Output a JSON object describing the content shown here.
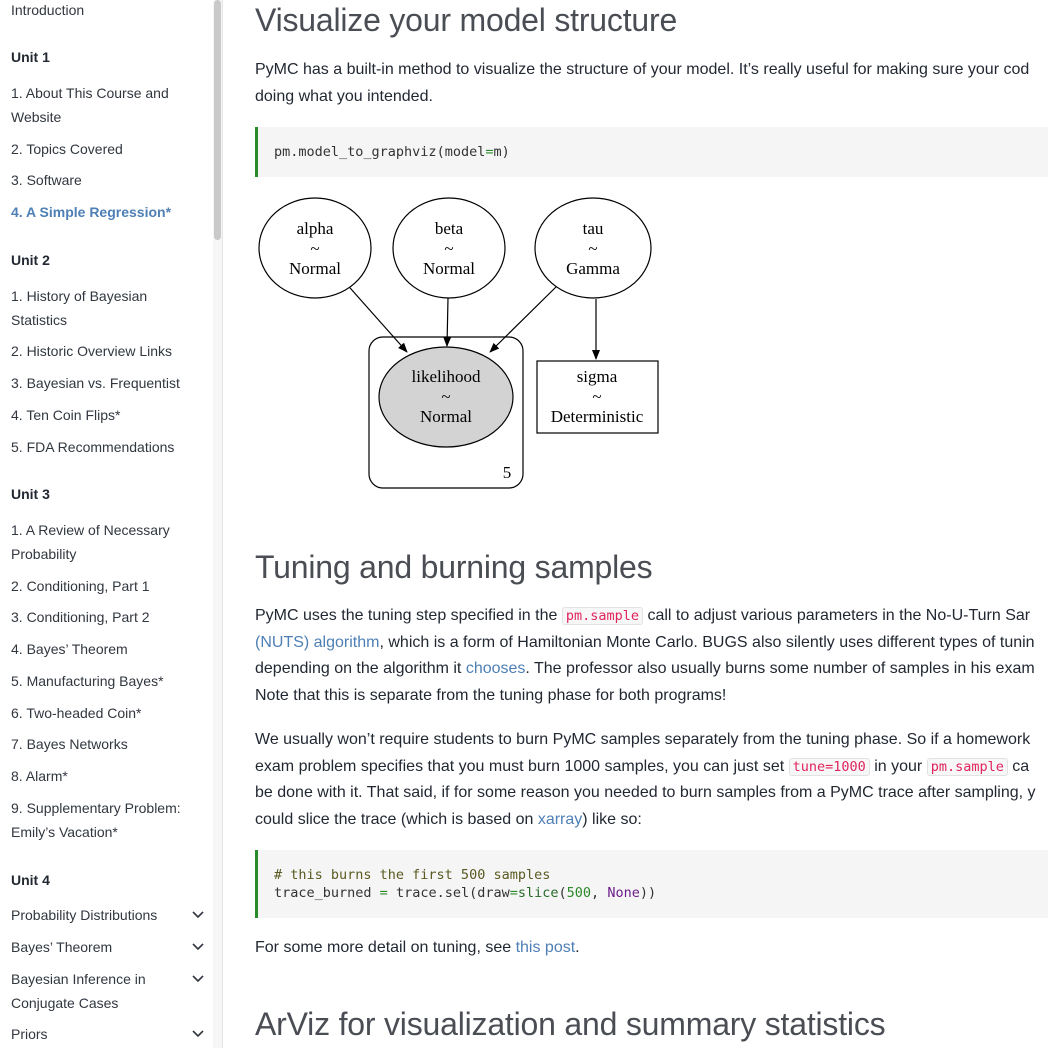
{
  "sidebar": {
    "intro": "Introduction",
    "units": [
      {
        "heading": "Unit 1",
        "items": [
          {
            "label_lines": [
              "1. About This Course and",
              "Website"
            ]
          },
          {
            "label_lines": [
              "2. Topics Covered"
            ]
          },
          {
            "label_lines": [
              "3. Software"
            ]
          },
          {
            "label_lines": [
              "4. A Simple Regression*"
            ],
            "active": true
          }
        ]
      },
      {
        "heading": "Unit 2",
        "items": [
          {
            "label_lines": [
              "1. History of Bayesian",
              "Statistics"
            ]
          },
          {
            "label_lines": [
              "2. Historic Overview Links"
            ]
          },
          {
            "label_lines": [
              "3. Bayesian vs. Frequentist"
            ]
          },
          {
            "label_lines": [
              "4. Ten Coin Flips*"
            ]
          },
          {
            "label_lines": [
              "5. FDA Recommendations"
            ]
          }
        ]
      },
      {
        "heading": "Unit 3",
        "items": [
          {
            "label_lines": [
              "1. A Review of Necessary",
              "Probability"
            ]
          },
          {
            "label_lines": [
              "2. Conditioning, Part 1"
            ]
          },
          {
            "label_lines": [
              "3. Conditioning, Part 2"
            ]
          },
          {
            "label_lines": [
              "4. Bayes’ Theorem"
            ]
          },
          {
            "label_lines": [
              "5. Manufacturing Bayes*"
            ]
          },
          {
            "label_lines": [
              "6. Two-headed Coin*"
            ]
          },
          {
            "label_lines": [
              "7. Bayes Networks"
            ]
          },
          {
            "label_lines": [
              "8. Alarm*"
            ]
          },
          {
            "label_lines": [
              "9. Supplementary Problem:",
              "Emily’s Vacation*"
            ]
          }
        ]
      },
      {
        "heading": "Unit 4",
        "collapsible": [
          {
            "label_lines": [
              "Probability Distributions"
            ]
          },
          {
            "label_lines": [
              "Bayes’ Theorem"
            ]
          },
          {
            "label_lines": [
              "Bayesian Inference in",
              "Conjugate Cases"
            ]
          },
          {
            "label_lines": [
              "Priors"
            ]
          }
        ]
      }
    ]
  },
  "main": {
    "section1": {
      "title": "Visualize your model structure",
      "para_line1": "PyMC has a built-in method to visualize the structure of your model. It’s really useful for making sure your cod",
      "para_line2": "doing what you intended.",
      "code": {
        "fn": "pm.model_to_graphviz",
        "open": "(model",
        "eq": "=",
        "arg": "m",
        "close": ")"
      }
    },
    "graph": {
      "alpha": {
        "name": "alpha",
        "tilde": "~",
        "dist": "Normal"
      },
      "beta": {
        "name": "beta",
        "tilde": "~",
        "dist": "Normal"
      },
      "tau": {
        "name": "tau",
        "tilde": "~",
        "dist": "Gamma"
      },
      "likelihood": {
        "name": "likelihood",
        "tilde": "~",
        "dist": "Normal"
      },
      "sigma": {
        "name": "sigma",
        "tilde": "~",
        "dist": "Deterministic"
      },
      "plate_count": "5"
    },
    "section2": {
      "title": "Tuning and burning samples",
      "p1": {
        "l1_a": "PyMC uses the tuning step specified in the ",
        "l1_code": "pm.sample",
        "l1_b": " call to adjust various parameters in the No-U-Turn Sar",
        "l2_link": "(NUTS) algorithm",
        "l2_b": ", which is a form of Hamiltonian Monte Carlo. BUGS also silently uses different types of tunin",
        "l3_a": "depending on the algorithm it ",
        "l3_link": "chooses",
        "l3_b": ". The professor also usually burns some number of samples in his exam",
        "l4": "Note that this is separate from the tuning phase for both programs!"
      },
      "p2": {
        "l1": "We usually won’t require students to burn PyMC samples separately from the tuning phase. So if a homework",
        "l2_a": "exam problem specifies that you must burn 1000 samples, you can just set ",
        "l2_code1": "tune=1000",
        "l2_b": " in your ",
        "l2_code2": "pm.sample",
        "l2_c": " ca",
        "l3": "be done with it. That said, if for some reason you needed to burn samples from a PyMC trace after sampling, y",
        "l4_a": "could slice the trace (which is based on ",
        "l4_link": "xarray",
        "l4_b": ") like so:"
      },
      "code": {
        "comment": "# this burns the first 500 samples",
        "l2_a": "trace_burned ",
        "l2_eq": "=",
        "l2_b": " trace.sel(draw",
        "l2_eq2": "=",
        "l2_fn": "slice",
        "l2_c": "(",
        "l2_num": "500",
        "l2_d": ", ",
        "l2_none": "None",
        "l2_e": "))"
      },
      "p3_a": "For some more detail on tuning, see ",
      "p3_link": "this post",
      "p3_b": "."
    },
    "section3": {
      "title": "ArViz for visualization and summary statistics"
    }
  }
}
